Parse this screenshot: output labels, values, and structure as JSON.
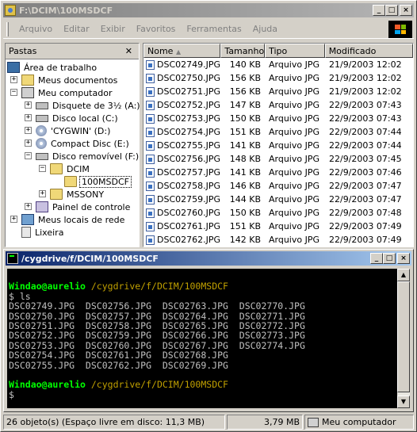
{
  "window": {
    "title": "F:\\DCIM\\100MSDCF"
  },
  "menu": [
    "Arquivo",
    "Editar",
    "Exibir",
    "Favoritos",
    "Ferramentas",
    "Ajuda"
  ],
  "folders": {
    "header": "Pastas",
    "close": "✕",
    "tree": [
      {
        "label": "Área de trabalho",
        "icon": "desktop-icon"
      },
      {
        "label": "Meus documentos",
        "icon": "my-documents-icon"
      },
      {
        "label": "Meu computador",
        "icon": "my-computer-icon"
      },
      {
        "label": "Disquete de 3½ (A:)",
        "icon": "floppy-drive-icon"
      },
      {
        "label": "Disco local (C:)",
        "icon": "hard-drive-icon"
      },
      {
        "label": "'CYGWIN' (D:)",
        "icon": "cd-drive-icon"
      },
      {
        "label": "Compact Disc (E:)",
        "icon": "cd-drive-icon"
      },
      {
        "label": "Disco removível (F:)",
        "icon": "removable-drive-icon"
      },
      {
        "label": "DCIM",
        "icon": "folder-open-icon"
      },
      {
        "label": "100MSDCF",
        "icon": "folder-open-icon"
      },
      {
        "label": "MSSONY",
        "icon": "folder-icon"
      },
      {
        "label": "Painel de controle",
        "icon": "control-panel-icon"
      },
      {
        "label": "Meus locais de rede",
        "icon": "network-places-icon"
      },
      {
        "label": "Lixeira",
        "icon": "recycle-bin-icon"
      }
    ]
  },
  "filelist": {
    "columns": [
      "Nome",
      "Tamanho",
      "Tipo",
      "Modificado"
    ],
    "rows": [
      [
        "DSC02749.JPG",
        "140 KB",
        "Arquivo JPG",
        "21/9/2003 12:02"
      ],
      [
        "DSC02750.JPG",
        "156 KB",
        "Arquivo JPG",
        "21/9/2003 12:02"
      ],
      [
        "DSC02751.JPG",
        "156 KB",
        "Arquivo JPG",
        "21/9/2003 12:02"
      ],
      [
        "DSC02752.JPG",
        "147 KB",
        "Arquivo JPG",
        "22/9/2003 07:43"
      ],
      [
        "DSC02753.JPG",
        "150 KB",
        "Arquivo JPG",
        "22/9/2003 07:43"
      ],
      [
        "DSC02754.JPG",
        "151 KB",
        "Arquivo JPG",
        "22/9/2003 07:44"
      ],
      [
        "DSC02755.JPG",
        "141 KB",
        "Arquivo JPG",
        "22/9/2003 07:44"
      ],
      [
        "DSC02756.JPG",
        "148 KB",
        "Arquivo JPG",
        "22/9/2003 07:45"
      ],
      [
        "DSC02757.JPG",
        "141 KB",
        "Arquivo JPG",
        "22/9/2003 07:46"
      ],
      [
        "DSC02758.JPG",
        "146 KB",
        "Arquivo JPG",
        "22/9/2003 07:47"
      ],
      [
        "DSC02759.JPG",
        "144 KB",
        "Arquivo JPG",
        "22/9/2003 07:47"
      ],
      [
        "DSC02760.JPG",
        "150 KB",
        "Arquivo JPG",
        "22/9/2003 07:48"
      ],
      [
        "DSC02761.JPG",
        "151 KB",
        "Arquivo JPG",
        "22/9/2003 07:49"
      ],
      [
        "DSC02762.JPG",
        "142 KB",
        "Arquivo JPG",
        "22/9/2003 07:49"
      ]
    ]
  },
  "terminal": {
    "title": "/cygdrive/f/DCIM/100MSDCF",
    "prompt_user": "Windao@aurelio",
    "prompt_path": "/cygdrive/f/DCIM/100MSDCF",
    "command": "$ ls",
    "ls_lines": [
      "DSC02749.JPG  DSC02756.JPG  DSC02763.JPG  DSC02770.JPG",
      "DSC02750.JPG  DSC02757.JPG  DSC02764.JPG  DSC02771.JPG",
      "DSC02751.JPG  DSC02758.JPG  DSC02765.JPG  DSC02772.JPG",
      "DSC02752.JPG  DSC02759.JPG  DSC02766.JPG  DSC02773.JPG",
      "DSC02753.JPG  DSC02760.JPG  DSC02767.JPG  DSC02774.JPG",
      "DSC02754.JPG  DSC02761.JPG  DSC02768.JPG",
      "DSC02755.JPG  DSC02762.JPG  DSC02769.JPG"
    ],
    "final_prompt": "$"
  },
  "statusbar": {
    "objects": "26 objeto(s) (Espaço livre em disco: 11,3 MB)",
    "size": "3,79 MB",
    "location": "Meu computador"
  }
}
